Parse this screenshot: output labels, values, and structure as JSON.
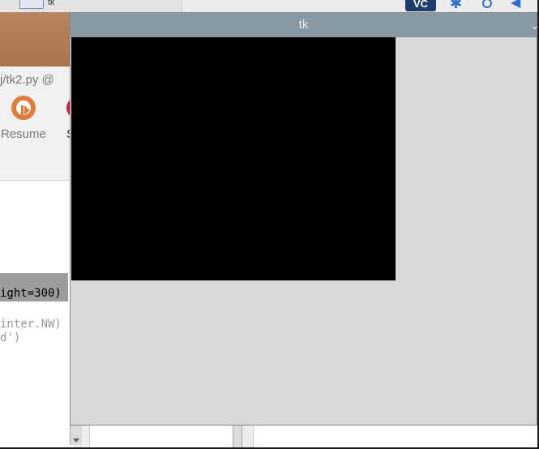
{
  "taskbar": {
    "window_button_label": "tk",
    "tray": {
      "vnc_label": "VC",
      "bluetooth_icon": "bluetooth-icon",
      "network_icon": "network-icon",
      "volume_icon": "volume-icon"
    }
  },
  "ide": {
    "file_path": "j/tk2.py  @",
    "resume_label": "Resume",
    "stop_label": "S",
    "code_lines": [
      "ight=300)",
      "inter.NW)",
      "d')"
    ],
    "colors": {
      "header": "#b37c57",
      "resume": "#e07b3a",
      "stop": "#c4203f"
    }
  },
  "tk_window": {
    "title": "tk",
    "menu_icon": "chevron-down-icon",
    "canvas_color": "#000000",
    "background_color": "#d9d9d9",
    "titlebar_color": "#8799a3"
  }
}
